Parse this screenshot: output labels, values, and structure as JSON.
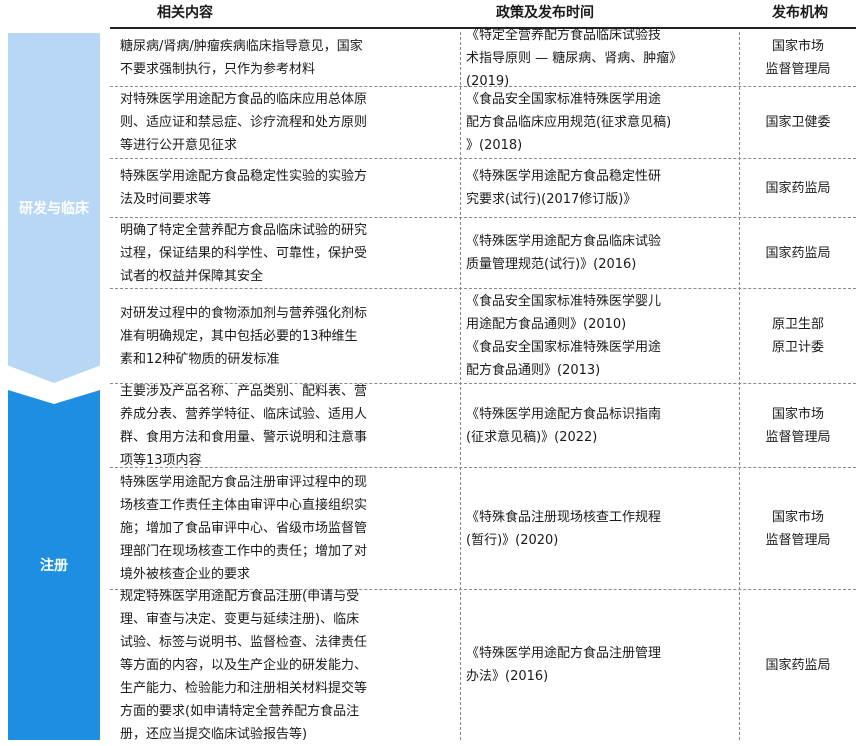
{
  "header": {
    "content": "相关内容",
    "policy": "政策及发布时间",
    "agency": "发布机构"
  },
  "categories": {
    "rd": "研发与临床",
    "reg": "注册"
  },
  "rows": [
    {
      "content": "糖尿病/肾病/肿瘤疾病临床指导意见，国家\n不要求强制执行，只作为参考材料",
      "policy": "《特定全营养配方食品临床试验技\n术指导原则 — 糖尿病、肾病、肿瘤》\n(2019)",
      "agency": "国家市场\n监督管理局"
    },
    {
      "content": "对特殊医学用途配方食品的临床应用总体原\n则、适应证和禁忌症、诊疗流程和处方原则\n等进行公开意见征求",
      "policy": "《食品安全国家标准特殊医学用途\n配方食品临床应用规范(征求意见稿)\n》(2018)",
      "agency": "国家卫健委"
    },
    {
      "content": "特殊医学用途配方食品稳定性实验的实验方\n法及时间要求等",
      "policy": "《特殊医学用途配方食品稳定性研\n究要求(试行)(2017修订版)》",
      "agency": "国家药监局"
    },
    {
      "content": "明确了特定全营养配方食品临床试验的研究\n过程，保证结果的科学性、可靠性，保护受\n试者的权益并保障其安全",
      "policy": "《特殊医学用途配方食品临床试验\n质量管理规范(试行)》(2016)",
      "agency": "国家药监局"
    },
    {
      "content": "对研发过程中的食物添加剂与营养强化剂标\n准有明确规定，其中包括必要的13种维生\n素和12种矿物质的研发标准",
      "policy": "《食品安全国家标准特殊医学婴儿\n用途配方食品通则》(2010)\n《食品安全国家标准特殊医学用途\n配方食品通则》(2013)",
      "agency": "原卫生部\n原卫计委"
    },
    {
      "content": "主要涉及产品名称、产品类别、配料表、营\n养成分表、营养学特征、临床试验、适用人\n群、食用方法和食用量、警示说明和注意事\n项等13项内容",
      "policy": "《特殊医学用途配方食品标识指南\n(征求意见稿)》(2022)",
      "agency": "国家市场\n监督管理局"
    },
    {
      "content": "特殊医学用途配方食品注册审评过程中的现\n场核查工作责任主体由审评中心直接组织实\n施；增加了食品审评中心、省级市场监督管\n理部门在现场核查工作中的责任；增加了对\n境外被核查企业的要求",
      "policy": "《特殊食品注册现场核查工作规程\n(暂行)》(2020)",
      "agency": "国家市场\n监督管理局"
    },
    {
      "content": "规定特殊医学用途配方食品注册(申请与受\n理、审查与决定、变更与延续注册)、临床\n试验、标签与说明书、监督检查、法律责任\n等方面的内容，以及生产企业的研发能力、\n生产能力、检验能力和注册相关材料提交等\n方面的要求(如申请特定全营养配方食品注\n册，还应当提交临床试验报告等)",
      "policy": "《特殊医学用途配方食品注册管理\n办法》(2016)",
      "agency": "国家药监局"
    }
  ]
}
